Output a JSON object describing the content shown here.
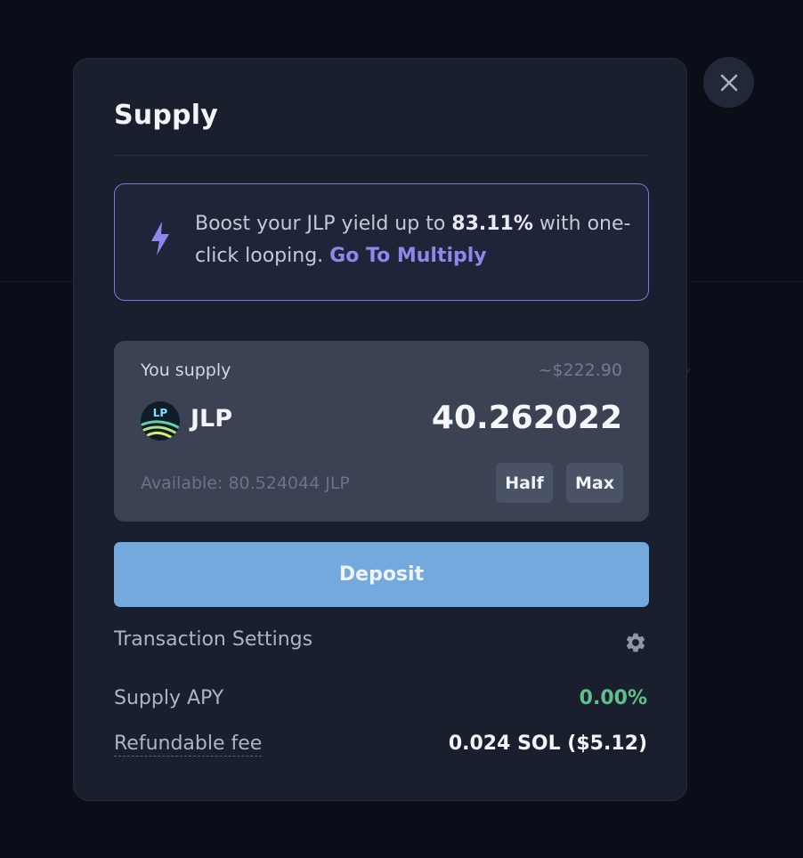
{
  "modal": {
    "title": "Supply",
    "close_icon": "close-icon"
  },
  "promo": {
    "icon": "lightning-icon",
    "text_before": "Boost your JLP yield up to ",
    "highlight": "83.11%",
    "text_after": " with one-click looping. ",
    "link": "Go To Multiply",
    "accent_color": "#8c89ea"
  },
  "supply": {
    "label": "You supply",
    "usd_value": "~$222.90",
    "token_icon": "jlp-token-logo",
    "token_logo_text": "LP",
    "token_symbol": "JLP",
    "amount": "40.262022",
    "available": "Available: 80.524044 JLP",
    "half_label": "Half",
    "max_label": "Max"
  },
  "deposit": {
    "label": "Deposit",
    "color": "#74a9de"
  },
  "transaction_settings": {
    "label": "Transaction Settings",
    "icon": "gear-icon"
  },
  "stats": {
    "supply_apy_label": "Supply APY",
    "supply_apy_value": "0.00%",
    "supply_apy_color": "#5fc08c",
    "refundable_fee_label": "Refundable fee",
    "refundable_fee_value": "0.024 SOL ($5.12)"
  }
}
